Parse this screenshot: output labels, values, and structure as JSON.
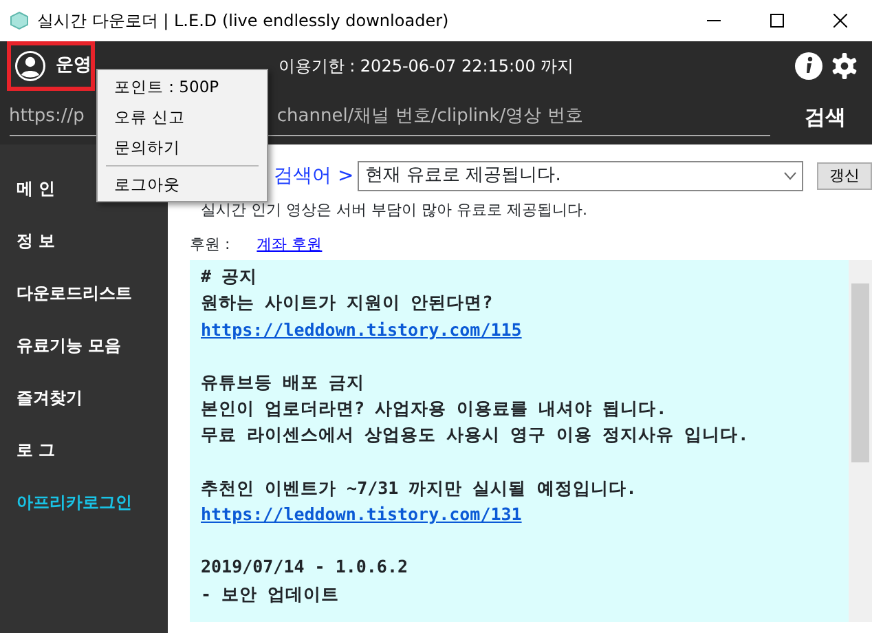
{
  "window": {
    "title": "실시간 다운로더 | L.E.D (live endlessly downloader)"
  },
  "header": {
    "user_name": "운영",
    "expiry": "이용기한 : 2025-06-07 22:15:00 까지",
    "highlighted": true
  },
  "search": {
    "placeholder_start": "https://p",
    "placeholder_end": "channel/채널 번호/cliplink/영상 번호",
    "button": "검색"
  },
  "user_menu": [
    {
      "label": "포인트 : 500P",
      "kind": "item"
    },
    {
      "label": "오류 신고",
      "kind": "item"
    },
    {
      "label": "문의하기",
      "kind": "item"
    },
    {
      "kind": "separator"
    },
    {
      "label": "로그아웃",
      "kind": "item"
    }
  ],
  "sidebar": {
    "items": [
      {
        "label": "메 인",
        "color": "#ffffff"
      },
      {
        "label": "정 보",
        "color": "#ffffff"
      },
      {
        "label": "다운로드리스트",
        "color": "#ffffff"
      },
      {
        "label": "유료기능 모음",
        "color": "#ffffff"
      },
      {
        "label": "즐겨찾기",
        "color": "#ffffff"
      },
      {
        "label": "로 그",
        "color": "#ffffff"
      },
      {
        "label": "아프리카로그인",
        "color": "#19c3e6"
      }
    ]
  },
  "main": {
    "search_label": "검색어 >",
    "dropdown_value": "현재 유료로 제공됩니다.",
    "refresh_button": "갱신",
    "info": "실시간 인기 영상은 서버 부담이 많아 유료로 제공됩니다.",
    "sponsor_label": "후원 :",
    "sponsor_link": "계좌 후원"
  },
  "notice": {
    "lines": [
      {
        "kind": "text",
        "text": "# 공지"
      },
      {
        "kind": "text",
        "text": "원하는 사이트가 지원이 안된다면?"
      },
      {
        "kind": "link",
        "text": "https://leddown.tistory.com/115"
      },
      {
        "kind": "blank"
      },
      {
        "kind": "text",
        "text": "유튜브등 배포 금지"
      },
      {
        "kind": "text",
        "text": "본인이 업로더라면? 사업자용 이용료를 내셔야 됩니다."
      },
      {
        "kind": "text",
        "text": "무료 라이센스에서 상업용도 사용시 영구 이용 정지사유 입니다."
      },
      {
        "kind": "blank"
      },
      {
        "kind": "text",
        "text": "추천인 이벤트가 ~7/31 까지만 실시될 예정입니다."
      },
      {
        "kind": "link",
        "text": "https://leddown.tistory.com/131"
      },
      {
        "kind": "blank"
      },
      {
        "kind": "text",
        "text": "2019/07/14 - 1.0.6.2"
      },
      {
        "kind": "text",
        "text": "- 보안 업데이트"
      }
    ]
  }
}
